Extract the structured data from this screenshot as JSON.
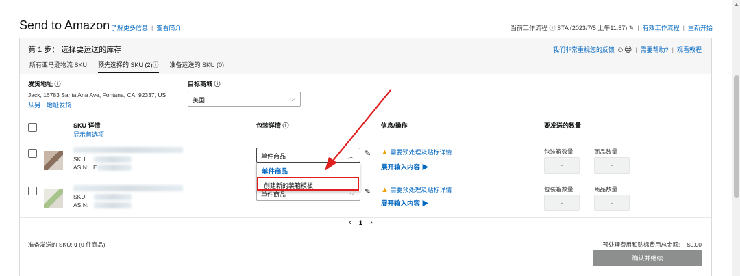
{
  "header": {
    "title": "Send to Amazon",
    "learn_more": "了解更多信息",
    "view_intro": "查看简介",
    "workflow_status": "当前工作流程 ⓘ STA (2023/7/5 上午11:57)",
    "valid_workflows": "有效工作流程",
    "restart": "重新开始"
  },
  "step": {
    "title": "第 1 步： 选择要运送的库存",
    "feedback": "我们非常重视您的反馈",
    "help": "需要帮助?",
    "tutorial": "观看教程"
  },
  "tabs": [
    {
      "label": "所有亚马逊物流 SKU"
    },
    {
      "label": "预先选择的 SKU (2)ⓘ"
    },
    {
      "label": "准备运送的 SKU (0)"
    }
  ],
  "ship_from": {
    "label": "发货地址 ⓘ",
    "address": "Jack, 16783 Santa Ana Ave, Fontana, CA, 92337, US",
    "other": "从另一地址发货"
  },
  "marketplace": {
    "label": "目标商城 ⓘ",
    "value": "美国"
  },
  "columns": {
    "sku": "SKU 详情",
    "show_options": "显示首选项",
    "packing": "包装详情 ⓘ",
    "info": "信息/操作",
    "quantity": "要发送的数量"
  },
  "rows": [
    {
      "sku_label": "SKU:",
      "asin_label": "ASIN:",
      "asin_fragment": "E",
      "packing_value": "单件商品",
      "warning": "需要预处理及贴标详情",
      "expand": "展开输入内容 ▶",
      "box_qty_label": "包装箱数量",
      "unit_qty_label": "商品数量",
      "box_qty": "-",
      "unit_qty": "-"
    },
    {
      "sku_label": "SKU:",
      "asin_label": "ASIN:",
      "asin_fragment": "",
      "packing_value": "单件商品",
      "warning": "需要预处理及贴标详情",
      "expand": "展开输入内容 ▶",
      "box_qty_label": "包装箱数量",
      "unit_qty_label": "商品数量",
      "box_qty": "-",
      "unit_qty": "-"
    }
  ],
  "dropdown": {
    "options": [
      "单件商品",
      "创建新的装箱模板"
    ]
  },
  "pagination": {
    "prev": "‹",
    "page": "1",
    "next": "›"
  },
  "footer": {
    "ready_label": "准备发送的 SKU:",
    "ready_count": "0",
    "ready_units": "(0 件商品)",
    "fee_label": "预处理费用和贴标费用总金额:",
    "fee_value": "$0.00",
    "confirm": "确认并继续"
  },
  "icons": {
    "pencil": "pencil-icon",
    "info": "info-icon",
    "smiley": "smiley-icon",
    "frown": "frown-icon",
    "warning": "warning-icon"
  },
  "colors": {
    "link": "#0066c0",
    "annotation": "#e02020",
    "button": "#8d8f8f",
    "warning": "#f0a000"
  }
}
